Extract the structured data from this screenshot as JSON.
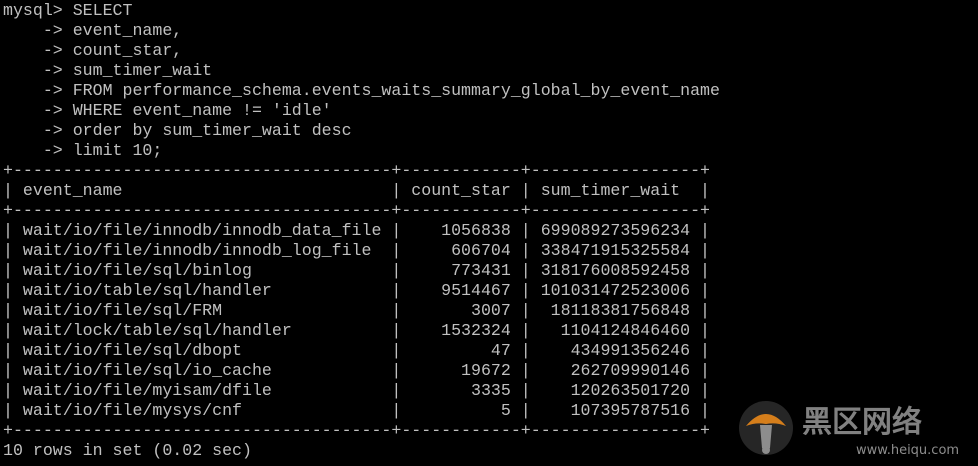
{
  "terminal": {
    "lines": [
      "mysql> SELECT",
      "    -> event_name,",
      "    -> count_star,",
      "    -> sum_timer_wait",
      "    -> FROM performance_schema.events_waits_summary_global_by_event_name",
      "    -> WHERE event_name != 'idle'",
      "    -> order by sum_timer_wait desc",
      "    -> limit 10;",
      "+--------------------------------------+------------+-----------------+",
      "| event_name                           | count_star | sum_timer_wait  |",
      "+--------------------------------------+------------+-----------------+",
      "| wait/io/file/innodb/innodb_data_file |    1056838 | 699089273596234 |",
      "| wait/io/file/innodb/innodb_log_file  |     606704 | 338471915325584 |",
      "| wait/io/file/sql/binlog              |     773431 | 318176008592458 |",
      "| wait/io/table/sql/handler            |    9514467 | 101031472523006 |",
      "| wait/io/file/sql/FRM                 |       3007 |  18118381756848 |",
      "| wait/lock/table/sql/handler          |    1532324 |   1104124846460 |",
      "| wait/io/file/sql/dbopt               |         47 |    434991356246 |",
      "| wait/io/file/sql/io_cache            |      19672 |    262709990146 |",
      "| wait/io/file/myisam/dfile            |       3335 |    120263501720 |",
      "| wait/io/file/mysys/cnf               |          5 |    107395787516 |",
      "+--------------------------------------+------------+-----------------+",
      "10 rows in set (0.02 sec)"
    ]
  },
  "watermark": {
    "title": "黑区网络",
    "url": "www.heiqu.com"
  },
  "colors": {
    "background": "#000000",
    "text": "#c0c0c0",
    "watermark_orange": "#e8891e",
    "watermark_text": "#9a9a9a"
  }
}
